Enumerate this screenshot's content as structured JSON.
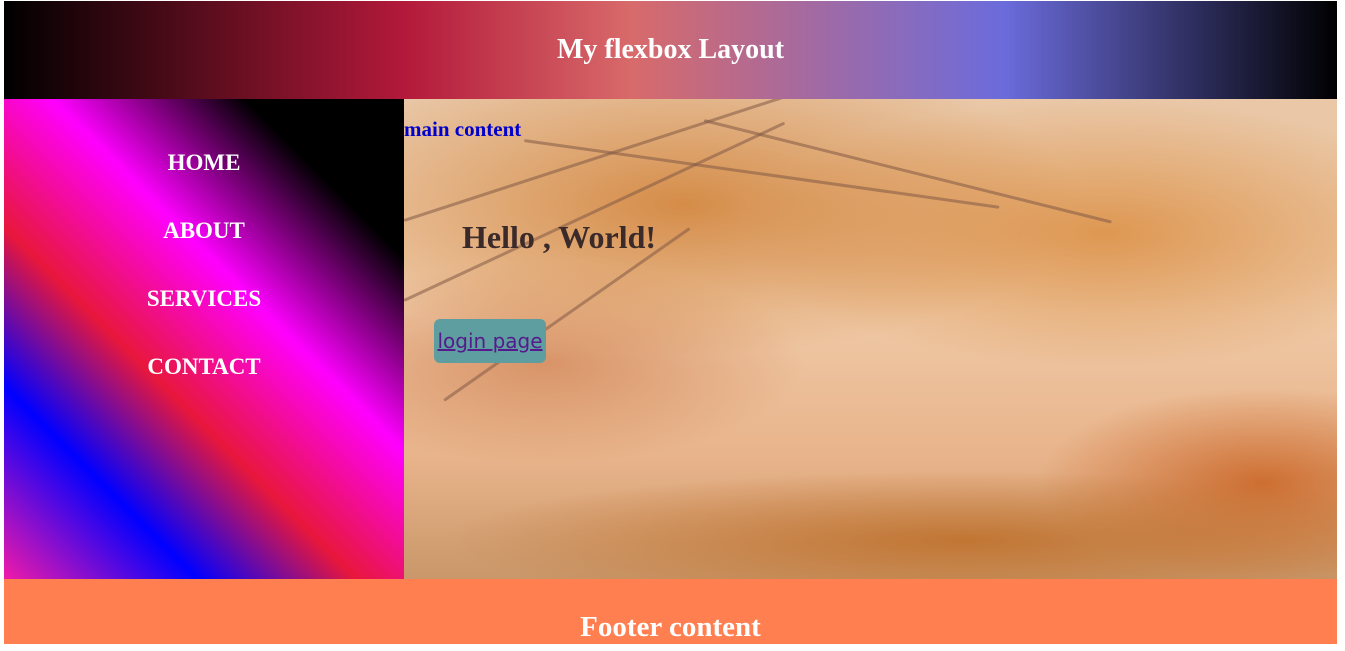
{
  "header": {
    "title": "My flexbox Layout"
  },
  "sidebar": {
    "items": [
      {
        "label": "HOME"
      },
      {
        "label": "ABOUT"
      },
      {
        "label": "SERVICES"
      },
      {
        "label": "CONTACT"
      }
    ]
  },
  "main": {
    "label": "main content",
    "heading": "Hello , World!",
    "login_link": "login page",
    "background_image": "autumn-lake-trees-scene"
  },
  "footer": {
    "text": "Footer content"
  },
  "colors": {
    "footer_bg": "#ff7f50",
    "login_button_bg": "#5f9ea0",
    "main_label_color": "#0000cc",
    "link_color": "#551a8b"
  }
}
